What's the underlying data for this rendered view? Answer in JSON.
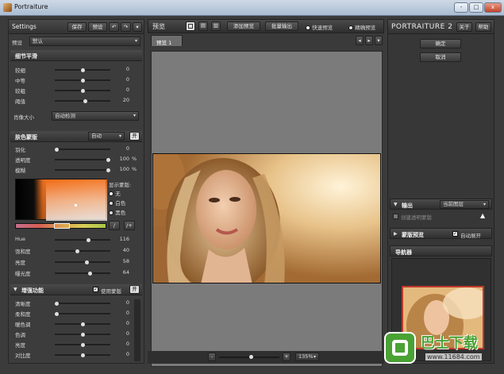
{
  "window": {
    "title": "Portraiture",
    "controls": [
      "-",
      "□",
      "x"
    ]
  },
  "left_panel": {
    "settings_label": "Settings",
    "save_label": "保存",
    "preset_btn_label": "预设",
    "preset_field_label": "预设",
    "preset_value": "默认",
    "detail_section": {
      "title": "细节平滑",
      "sliders": [
        {
          "label": "较细",
          "value": 0,
          "pos": 0.5
        },
        {
          "label": "中等",
          "value": 0,
          "pos": 0.5
        },
        {
          "label": "较粗",
          "value": 0,
          "pos": 0.5
        },
        {
          "label": "阈值",
          "value": 20,
          "pos": 0.55
        }
      ],
      "portrait_size_label": "肖像大小",
      "portrait_size_value": "自动检测"
    },
    "skin_section": {
      "title": "肤色蒙版",
      "mode_value": "自动",
      "toggle_label": "开",
      "sliders": [
        {
          "label": "羽化",
          "value": "0",
          "unit": "",
          "pos": 0.0
        },
        {
          "label": "透明度",
          "value": "100",
          "unit": "%",
          "pos": 1.0
        },
        {
          "label": "模糊",
          "value": "100",
          "unit": "%",
          "pos": 1.0
        }
      ],
      "show_mask_label": "显示蒙版:",
      "radio_options": [
        "无",
        "白色",
        "黑色"
      ],
      "hsl_sliders": [
        {
          "label": "Hue",
          "value": 116,
          "pos": 0.62
        },
        {
          "label": "饱和度",
          "value": 40,
          "pos": 0.4
        },
        {
          "label": "亮度",
          "value": 58,
          "pos": 0.58
        },
        {
          "label": "曝光度",
          "value": 64,
          "pos": 0.64
        }
      ]
    },
    "enhance_section": {
      "title": "增强功能",
      "use_mask_label": "使用蒙版",
      "toggle_label": "开",
      "sliders": [
        {
          "label": "清晰度",
          "value": 0,
          "pos": 0.0
        },
        {
          "label": "柔和度",
          "value": 0,
          "pos": 0.0
        },
        {
          "label": "暖色调",
          "value": 0,
          "pos": 0.5
        },
        {
          "label": "色调",
          "value": 0,
          "pos": 0.5
        },
        {
          "label": "亮度",
          "value": 0,
          "pos": 0.5
        },
        {
          "label": "对比度",
          "value": 0,
          "pos": 0.5
        }
      ]
    }
  },
  "center_panel": {
    "preview_label": "预览",
    "add_preview_label": "添加预览",
    "batch_output_label": "批量输出",
    "fast_preview_label": "快速预览",
    "precise_preview_label": "精确预览",
    "tab_label": "预览 1",
    "zoom_value": "135%",
    "zoom_minus": "-",
    "zoom_plus": "+"
  },
  "right_panel": {
    "brand": "PORTRAITURE 2",
    "about_label": "关于",
    "help_label": "帮助",
    "ok_label": "确定",
    "cancel_label": "取消",
    "output_label": "输出",
    "output_value": "当前图层",
    "create_mask_label": "创建透明蒙版",
    "mask_preview_label": "蒙版预览",
    "auto_expand_label": "自动展开",
    "navigator_label": "导航器"
  },
  "watermark": {
    "brand_text": "巴士下载",
    "url_text": "www.11684.com"
  },
  "colors": {
    "panel_bg": "#3c3c3c",
    "viewport_bg": "#7b7b7b",
    "accent_red": "#c0392b",
    "watermark_green": "#4aa235"
  }
}
